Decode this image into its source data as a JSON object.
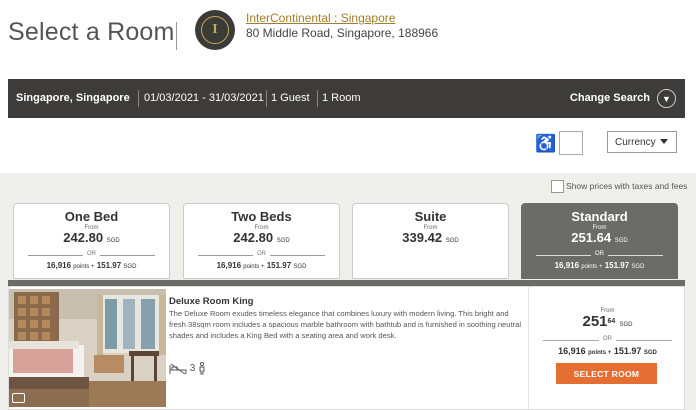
{
  "header": {
    "title": "Select a Room",
    "hotel_name": "InterContinental : Singapore",
    "hotel_address": "80 Middle Road, Singapore, 188966",
    "logo_letter": "I"
  },
  "search_bar": {
    "destination": "Singapore, Singapore",
    "dates": "01/03/2021 - 31/03/2021",
    "guests": "1 Guest",
    "rooms": "1 Room",
    "change_label": "Change Search"
  },
  "filters": {
    "currency_label": "Currency",
    "accessibility_icon": "wheelchair-icon",
    "tax_label": "Show prices with taxes and fees"
  },
  "tabs": [
    {
      "name": "One Bed",
      "from": "From",
      "price": "242.80",
      "currency": "SGD",
      "or": "OR",
      "points": "16,916",
      "points_label": "points +",
      "cash": "151.97",
      "cash_currency": "SGD"
    },
    {
      "name": "Two Beds",
      "from": "From",
      "price": "242.80",
      "currency": "SGD",
      "or": "OR",
      "points": "16,916",
      "points_label": "points +",
      "cash": "151.97",
      "cash_currency": "SGD"
    },
    {
      "name": "Suite",
      "from": "From",
      "price": "339.42",
      "currency": "SGD"
    },
    {
      "name": "Standard",
      "from": "From",
      "price": "251.64",
      "currency": "SGD",
      "or": "OR",
      "points": "16,916",
      "points_label": "points +",
      "cash": "151.97",
      "cash_currency": "SGD",
      "active": true
    }
  ],
  "room": {
    "name": "Deluxe Room King",
    "description": "The Deluxe Room exudes timeless elegance that combines luxury with modern living. This bright and fresh 38sqm room includes a spacious marble bathroom with bathtub and is furnished in soothing neutral shades and includes a King Bed with a seating area and work desk.",
    "occupancy": "3",
    "from": "From",
    "price_whole": "251",
    "price_cents": "64",
    "currency": "SGD",
    "or": "OR",
    "points": "16,916",
    "points_label": "points +",
    "cash": "151.97",
    "cash_currency": "SGD",
    "select_label": "SELECT ROOM"
  },
  "colors": {
    "accent": "#e56e33",
    "bar": "#3d3c3a",
    "active_tab": "#6b6b68",
    "gold": "#a07d2a"
  }
}
